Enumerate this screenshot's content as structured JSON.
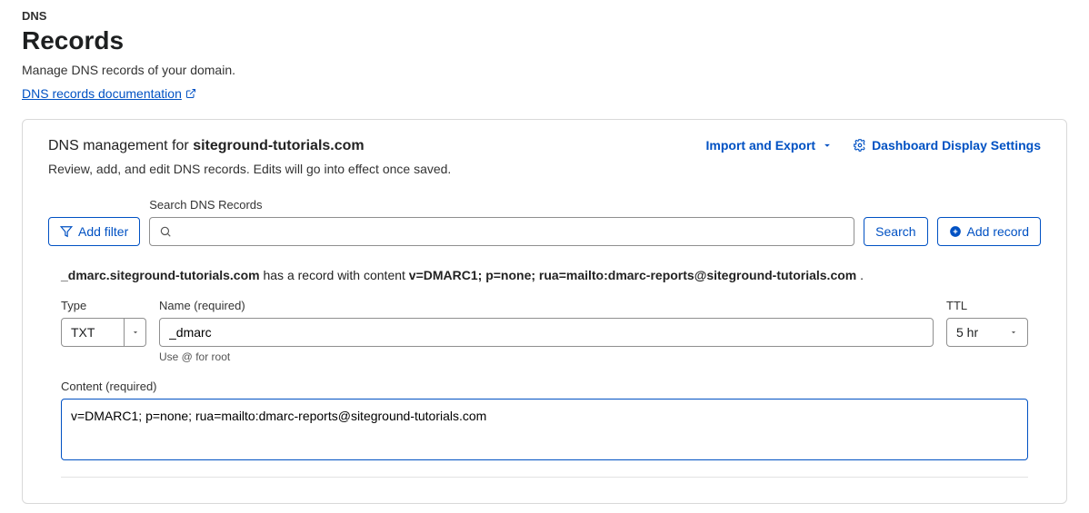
{
  "header": {
    "breadcrumb": "DNS",
    "title": "Records",
    "description": "Manage DNS records of your domain.",
    "doc_link": "DNS records documentation"
  },
  "card": {
    "title_prefix": "DNS management for ",
    "domain": "siteground-tutorials.com",
    "subtitle": "Review, add, and edit DNS records. Edits will go into effect once saved.",
    "import_export": "Import and Export",
    "dashboard_settings": "Dashboard Display Settings"
  },
  "toolbar": {
    "add_filter": "Add filter",
    "search_label": "Search DNS Records",
    "search_value": "",
    "search_btn": "Search",
    "add_record": "Add record"
  },
  "record": {
    "preview_name": "_dmarc.siteground-tutorials.com",
    "preview_mid": " has a record with content ",
    "preview_content": "v=DMARC1; p=none; rua=mailto:dmarc-reports@siteground-tutorials.com",
    "preview_trail": " .",
    "type_label": "Type",
    "type_value": "TXT",
    "name_label": "Name (required)",
    "name_value": "_dmarc",
    "name_hint": "Use @ for root",
    "ttl_label": "TTL",
    "ttl_value": "5 hr",
    "content_label": "Content (required)",
    "content_value": "v=DMARC1; p=none; rua=mailto:dmarc-reports@siteground-tutorials.com"
  }
}
